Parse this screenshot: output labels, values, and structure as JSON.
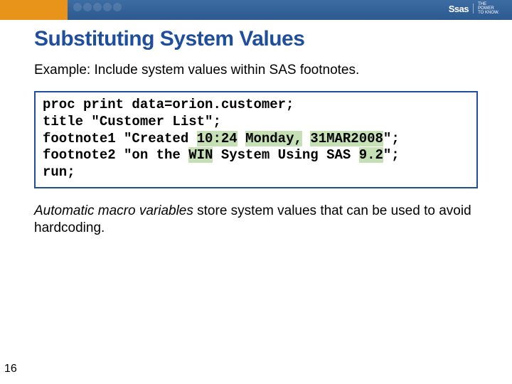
{
  "header": {
    "logo_text": "Ssas",
    "tagline_line1": "THE",
    "tagline_line2": "POWER",
    "tagline_line3": "TO KNOW."
  },
  "title": "Substituting System Values",
  "example_label": "Example:  Include system values within SAS footnotes.",
  "code": {
    "line1": "proc print data=orion.customer;",
    "line2": "title \"Customer List\";",
    "line3_a": "footnote1 \"Created ",
    "line3_hl1": "10:24",
    "line3_b": " ",
    "line3_hl2": "Monday,",
    "line3_c": " ",
    "line3_hl3": "31MAR2008",
    "line3_d": "\";",
    "line4_a": "footnote2 \"on the ",
    "line4_hl1": "WIN",
    "line4_b": " System Using SAS ",
    "line4_hl2": "9.2",
    "line4_c": "\";",
    "line5": "run;"
  },
  "explain_italic": "Automatic macro variables",
  "explain_rest": " store system values that can be used to avoid hardcoding.",
  "slide_number": "16"
}
